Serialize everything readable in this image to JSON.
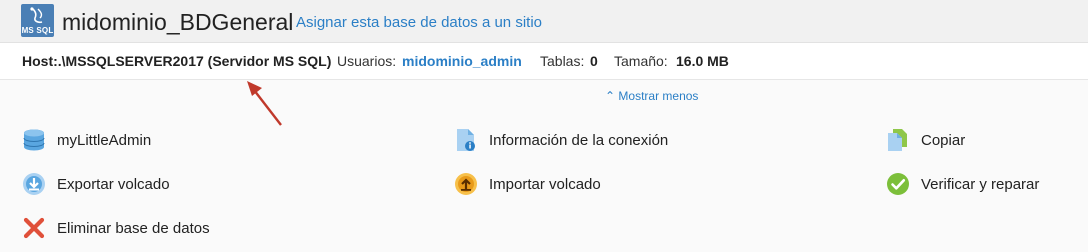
{
  "header": {
    "logo_text": "MS SQL",
    "title": "midominio_BDGeneral",
    "assign_link": "Asignar esta base de datos a un sitio"
  },
  "info": {
    "host": "Host:.\\MSSQLSERVER2017 (Servidor MS SQL)",
    "users_label": "Usuarios:",
    "users_value": "midominio_admin",
    "tables_label": "Tablas:",
    "tables_value": "0",
    "size_label": "Tamaño:",
    "size_value": "16.0 MB"
  },
  "toggle": {
    "label": "Mostrar menos",
    "icon": "chevron-up-icon"
  },
  "actions": [
    {
      "label": "myLittleAdmin",
      "icon": "database-icon"
    },
    {
      "label": "Información de la conexión",
      "icon": "connection-info-icon"
    },
    {
      "label": "Copiar",
      "icon": "copy-icon"
    },
    {
      "label": "Exportar volcado",
      "icon": "export-icon"
    },
    {
      "label": "Importar volcado",
      "icon": "import-icon"
    },
    {
      "label": "Verificar y reparar",
      "icon": "check-icon"
    },
    {
      "label": "Eliminar base de datos",
      "icon": "delete-icon"
    }
  ],
  "colors": {
    "link": "#2b7fc6",
    "annotation_arrow": "#c0392b",
    "logo_bg": "#4a7fb5"
  }
}
